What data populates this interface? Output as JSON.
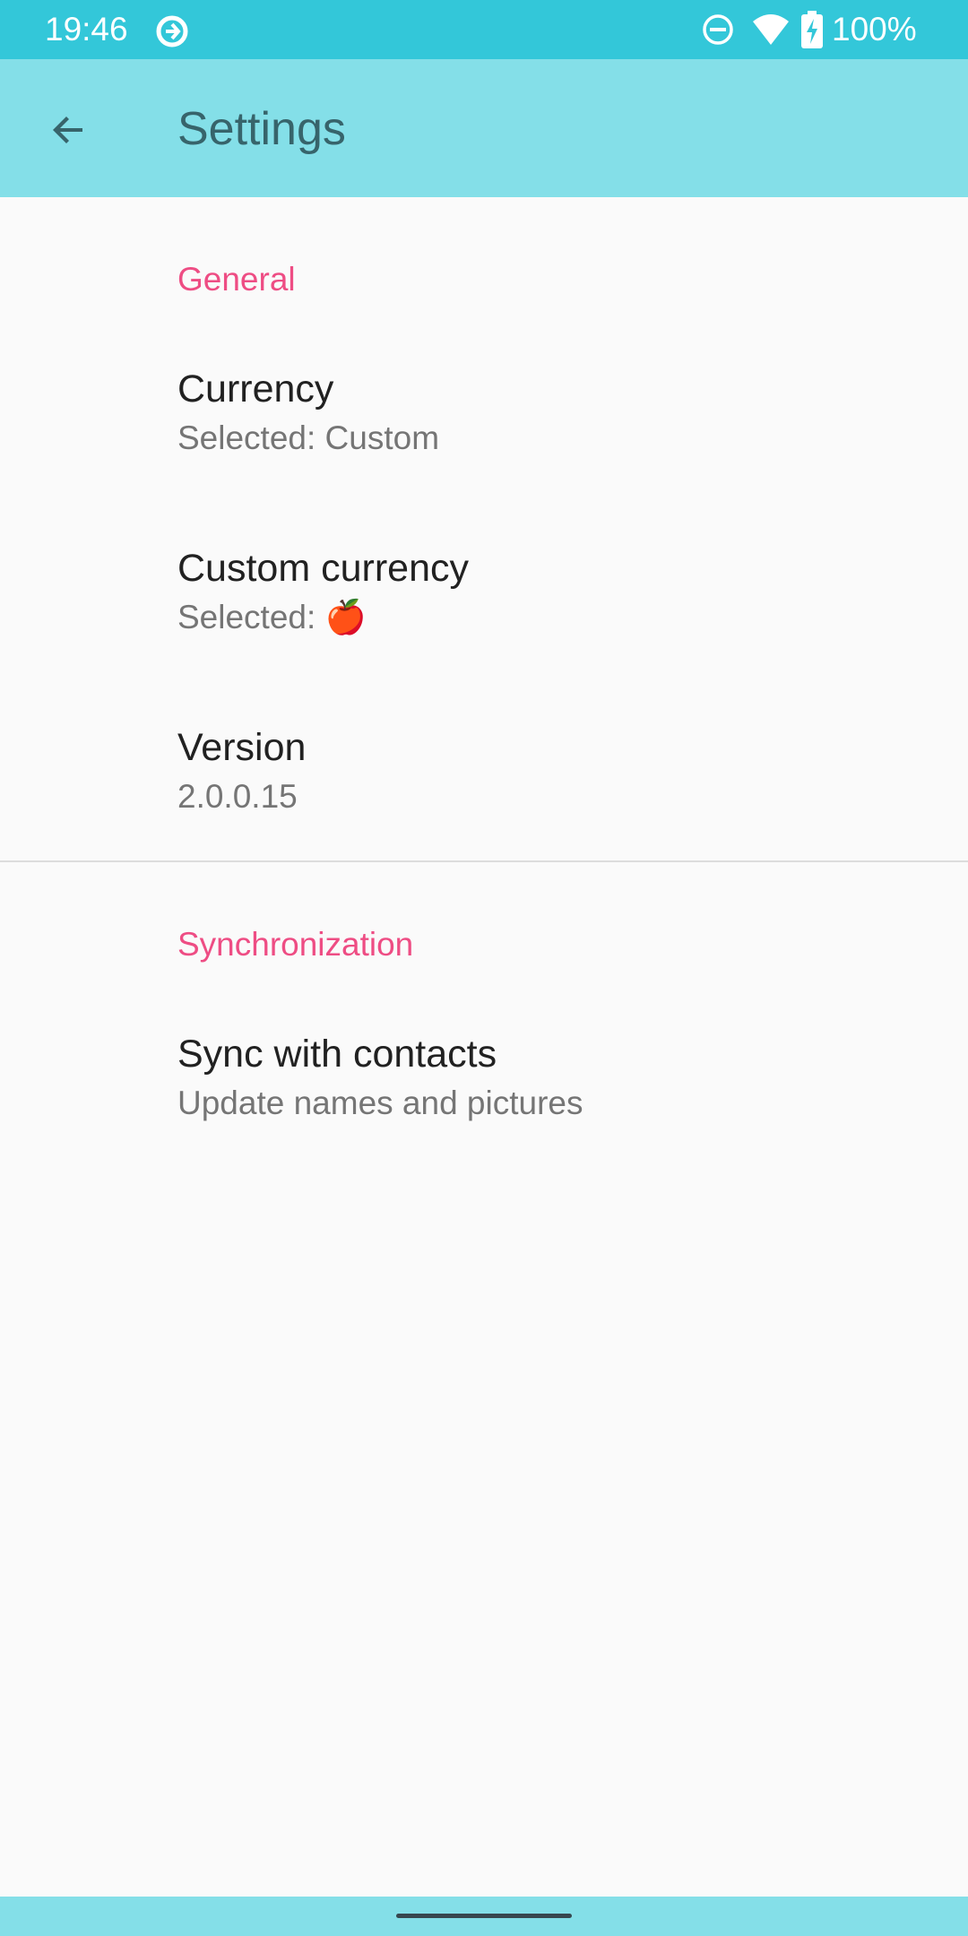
{
  "status_bar": {
    "time": "19:46",
    "battery_text": "100%"
  },
  "app_bar": {
    "title": "Settings",
    "back_icon": "arrow-back-icon"
  },
  "sections": [
    {
      "title": "General",
      "items": [
        {
          "title": "Currency",
          "summary": "Selected: Custom"
        },
        {
          "title": "Custom currency",
          "summary": "Selected: 🍎"
        },
        {
          "title": "Version",
          "summary": "2.0.0.15"
        }
      ]
    },
    {
      "title": "Synchronization",
      "items": [
        {
          "title": "Sync with contacts",
          "summary": "Update names and pictures"
        }
      ]
    }
  ],
  "colors": {
    "status_bar": "#33C7D9",
    "app_bar": "#84DFE8",
    "accent": "#EE4D84"
  }
}
